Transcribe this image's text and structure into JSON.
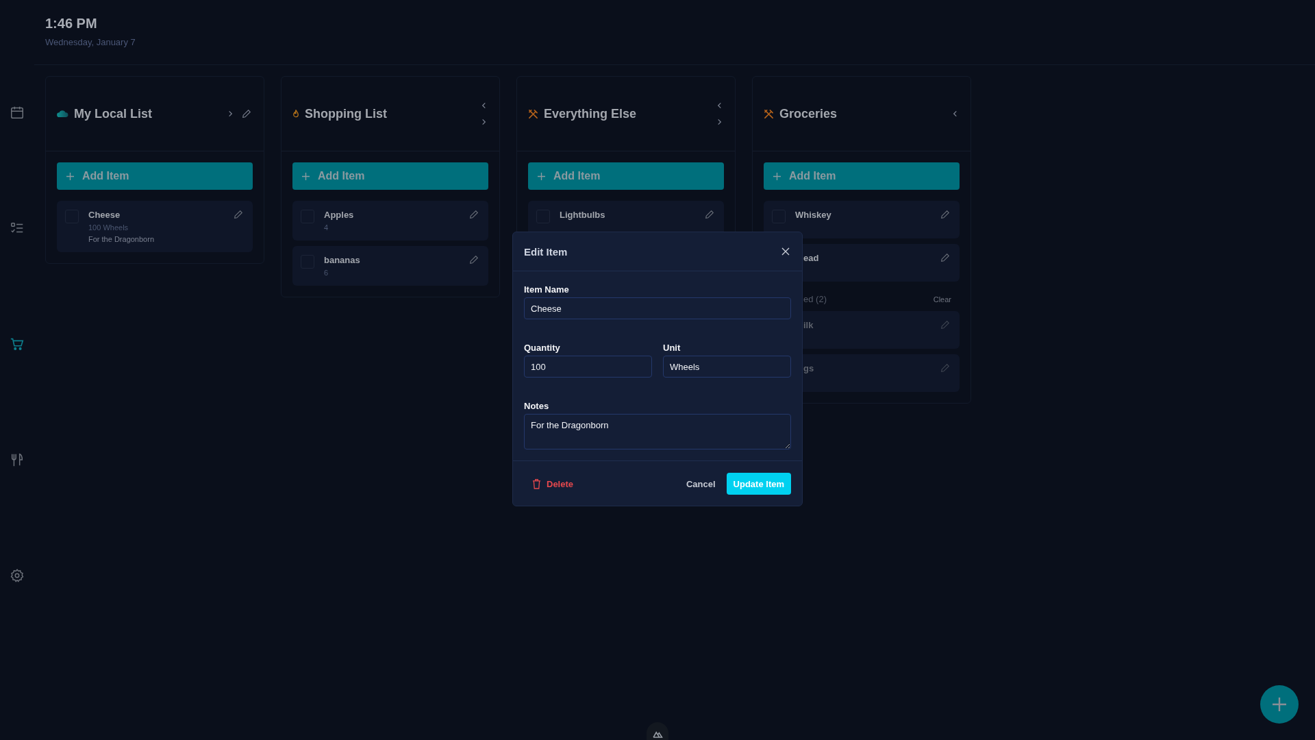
{
  "header": {
    "time": "1:46 PM",
    "date": "Wednesday, January 7"
  },
  "sidebar": {
    "items": [
      {
        "kind": "calendar",
        "selected": false
      },
      {
        "kind": "checklist",
        "selected": false
      },
      {
        "kind": "cart",
        "selected": true
      },
      {
        "kind": "utensils",
        "selected": false
      },
      {
        "kind": "settings",
        "selected": false
      }
    ]
  },
  "columns": [
    {
      "title": "My Local List",
      "kind": "cloud",
      "has_prev": false,
      "has_next": true,
      "editable": true,
      "add_label": "Add Item",
      "items": [
        {
          "kind": "full",
          "name": "Cheese",
          "checked": false,
          "details": [
            "100 Wheels",
            "For the Dragonborn"
          ]
        }
      ]
    },
    {
      "title": "Shopping List",
      "kind": "flame",
      "has_prev": true,
      "has_next": true,
      "editable": false,
      "add_label": "Add Item",
      "items": [
        {
          "kind": "full",
          "name": "Apples",
          "checked": false,
          "details": [
            "4"
          ]
        },
        {
          "kind": "full",
          "name": "bananas",
          "checked": false,
          "details": [
            "6"
          ]
        }
      ]
    },
    {
      "title": "Everything Else",
      "kind": "utensils",
      "has_prev": true,
      "has_next": true,
      "editable": false,
      "add_label": "Add Item",
      "items": [
        {
          "kind": "full",
          "name": "Lightbulbs",
          "checked": false
        }
      ]
    },
    {
      "title": "Groceries",
      "kind": "utensils",
      "has_prev": true,
      "has_next": false,
      "editable": false,
      "add_label": "Add Item",
      "items": [
        {
          "kind": "full",
          "name": "Whiskey",
          "checked": false
        },
        {
          "kind": "partial",
          "name": "ead",
          "checked": false
        }
      ],
      "checked_section": {
        "label": "ed (2)",
        "action": "Clear",
        "items": [
          {
            "kind": "partial",
            "name": "ilk",
            "checked": true
          },
          {
            "kind": "partial",
            "name": "gs",
            "checked": true
          }
        ]
      }
    }
  ],
  "modal": {
    "title": "Edit Item",
    "fields": [
      {
        "label": "Item Name",
        "value": "Cheese"
      }
    ],
    "row_fields": [
      {
        "label": "Quantity",
        "value": "100"
      },
      {
        "label": "Unit",
        "value": "Wheels"
      }
    ],
    "notes": {
      "label": "Notes",
      "value": "For the Dragonborn"
    },
    "delete_label": "Delete",
    "cancel_label": "Cancel",
    "submit_label": "Update Item"
  }
}
